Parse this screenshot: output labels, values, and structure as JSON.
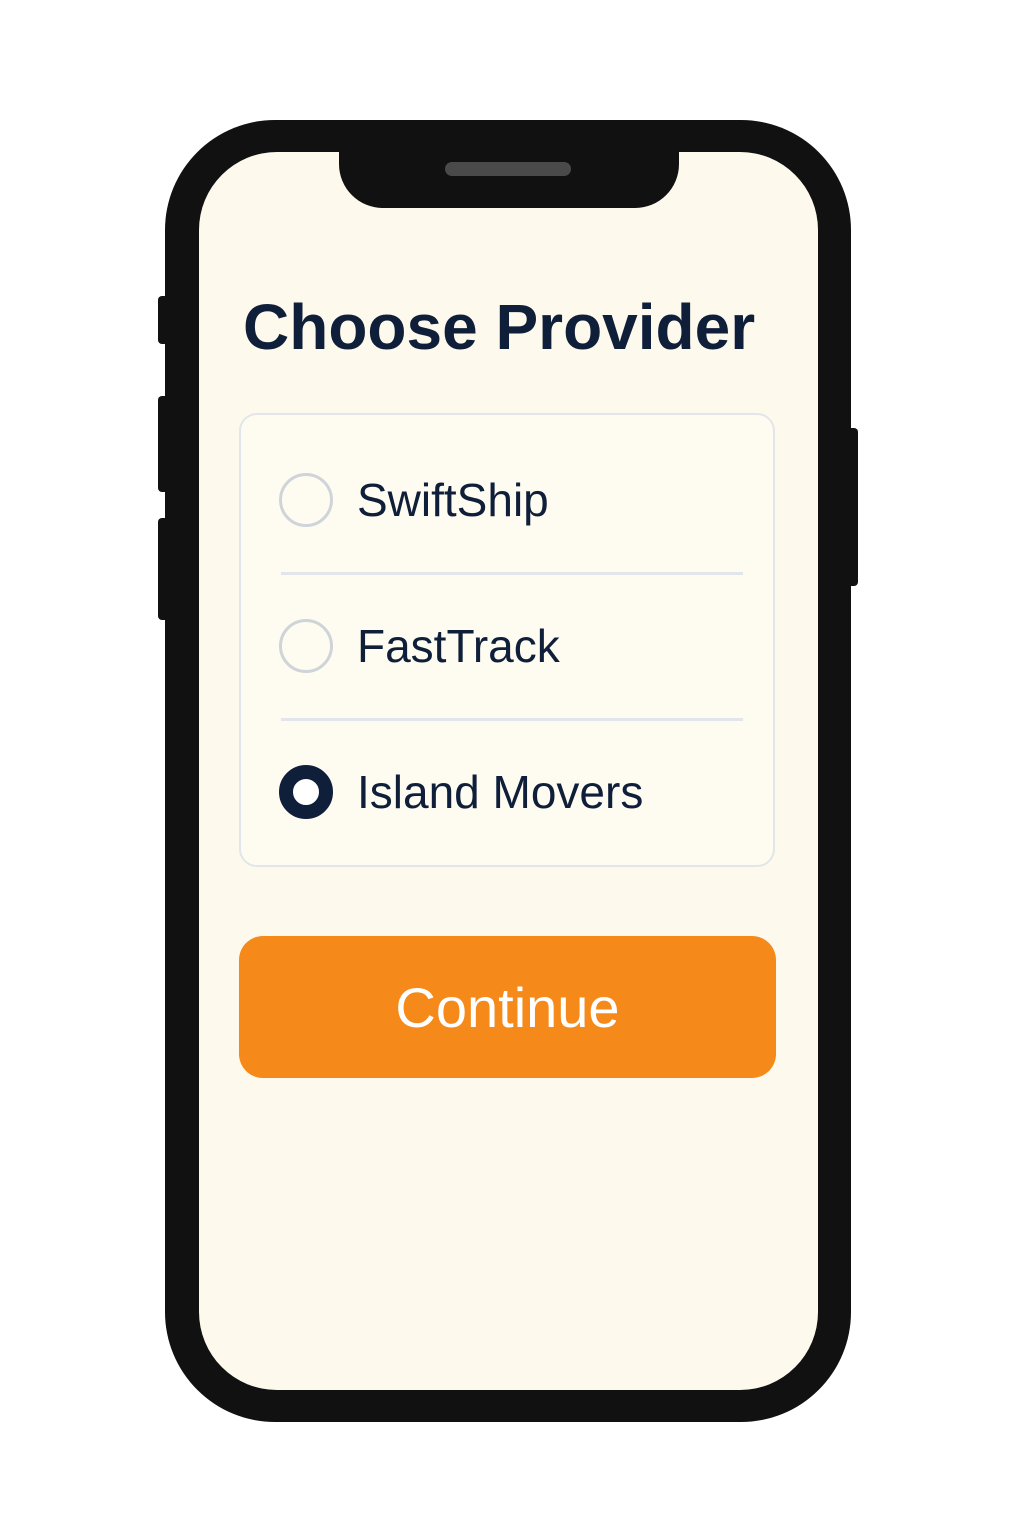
{
  "screen": {
    "title": "Choose Provider"
  },
  "providers": [
    {
      "label": "SwiftShip",
      "selected": false
    },
    {
      "label": "FastTrack",
      "selected": false
    },
    {
      "label": "Island Movers",
      "selected": true
    }
  ],
  "actions": {
    "continue_label": "Continue"
  },
  "colors": {
    "primary_text": "#0f1f3a",
    "accent": "#f5891a",
    "screen_background": "#fdf9ec",
    "radio_unselected_border": "#cfd4d8"
  }
}
